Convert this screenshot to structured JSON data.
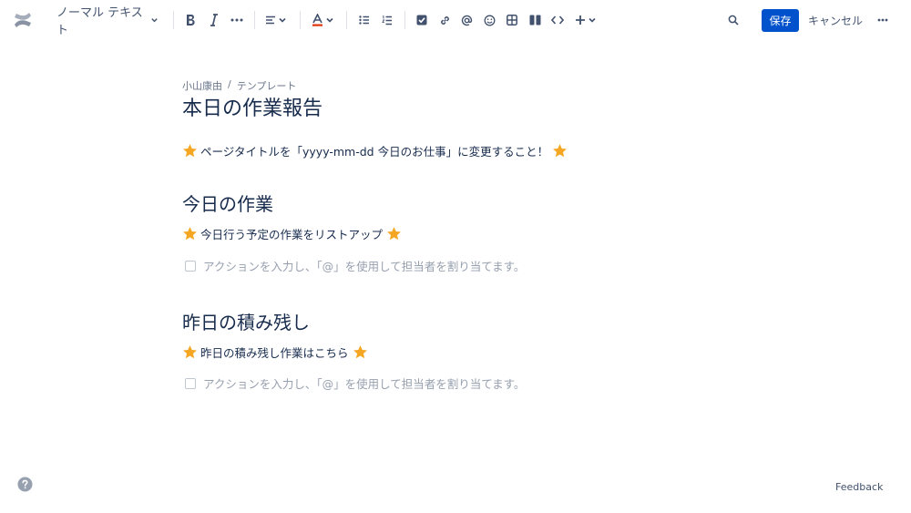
{
  "toolbar": {
    "text_style": "ノーマル テキスト",
    "save_label": "保存",
    "cancel_label": "キャンセル"
  },
  "page": {
    "breadcrumb": [
      "小山康由",
      "/",
      "テンプレート"
    ],
    "title": "本日の作業報告",
    "intro": "ページタイトルを「yyyy-mm-dd 今日のお仕事」に変更すること！",
    "sections": [
      {
        "heading": "今日の作業",
        "note": "今日行う予定の作業をリストアップ",
        "task_placeholder": "アクションを入力し、「@」を使用して担当者を割り当てます。"
      },
      {
        "heading": "昨日の積み残し",
        "note": "昨日の積み残し作業はこちら",
        "task_placeholder": "アクションを入力し、「@」を使用して担当者を割り当てます。"
      }
    ]
  },
  "footer": {
    "feedback_label": "Feedback"
  },
  "colors": {
    "primary": "#0052cc",
    "text": "#172b4d",
    "muted": "#97a0af",
    "star": "#f5a623"
  }
}
